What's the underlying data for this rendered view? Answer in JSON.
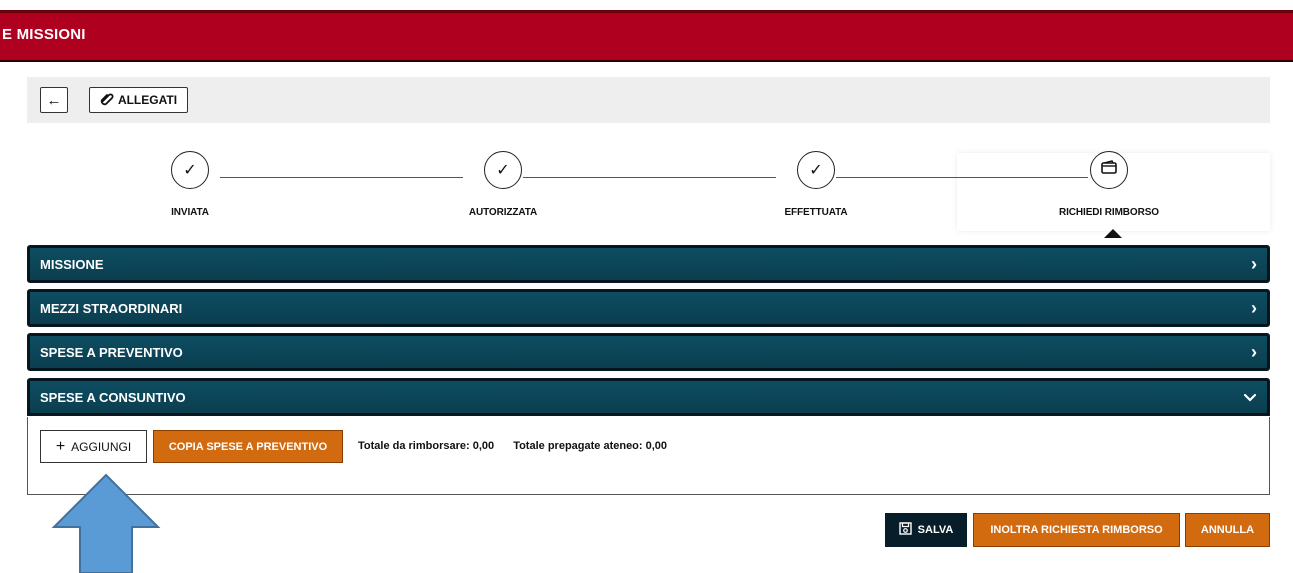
{
  "header": {
    "title": "E MISSIONI"
  },
  "toolbar": {
    "back_icon": "arrow-left-icon",
    "back_glyph": "←",
    "allegati_label": "ALLEGATI",
    "allegati_icon": "paperclip-icon"
  },
  "stepper": {
    "steps": [
      {
        "label": "INVIATA",
        "icon": "check-icon",
        "glyph": "✓"
      },
      {
        "label": "AUTORIZZATA",
        "icon": "check-icon",
        "glyph": "✓"
      },
      {
        "label": "EFFETTUATA",
        "icon": "check-icon",
        "glyph": "✓"
      },
      {
        "label": "RICHIEDI RIMBORSO",
        "icon": "wallet-icon",
        "active": true
      }
    ]
  },
  "accordion": {
    "sections": [
      {
        "title": "MISSIONE",
        "expanded": false,
        "chevron": "›"
      },
      {
        "title": "MEZZI STRAORDINARI",
        "expanded": false,
        "chevron": "›"
      },
      {
        "title": "SPESE A PREVENTIVO",
        "expanded": false,
        "chevron": "›"
      },
      {
        "title": "SPESE A CONSUNTIVO",
        "expanded": true,
        "chevron": "⌄"
      }
    ]
  },
  "consuntivo": {
    "add_label": "AGGIUNGI",
    "add_glyph": "+",
    "copy_label": "COPIA SPESE A PREVENTIVO",
    "totale_rimborsare": "Totale da rimborsare: 0,00",
    "totale_prepagate": "Totale prepagate ateneo: 0,00"
  },
  "actions": {
    "salva_label": "SALVA",
    "inoltra_label": "INOLTRA RICHIESTA RIMBORSO",
    "annulla_label": "ANNULLA"
  },
  "colors": {
    "header": "#b0001f",
    "accordion": "#0e4e63",
    "orange": "#d26a10",
    "dark_button": "#071e2a",
    "annotation_arrow": "#5b9bd5"
  }
}
